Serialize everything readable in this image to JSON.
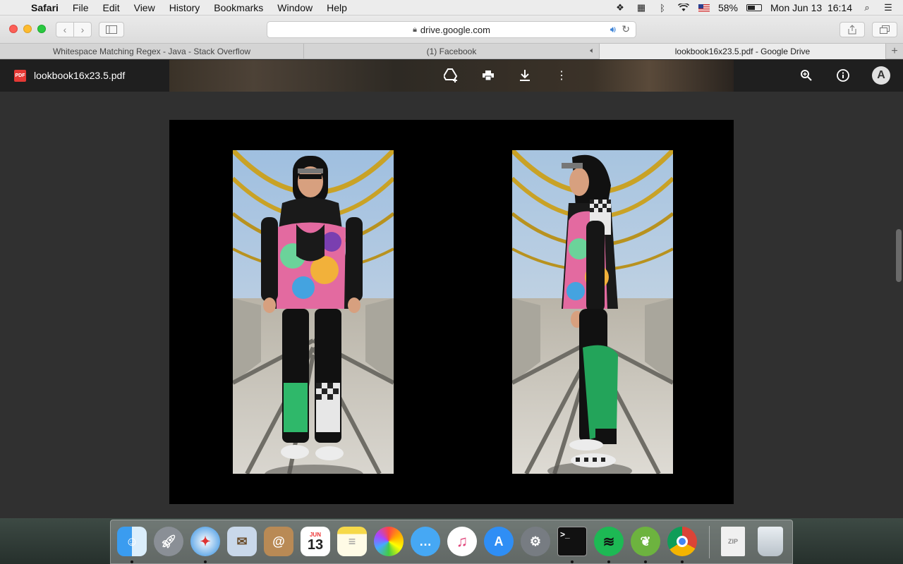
{
  "menubar": {
    "app": "Safari",
    "items": [
      "File",
      "Edit",
      "View",
      "History",
      "Bookmarks",
      "Window",
      "Help"
    ],
    "battery": "58%",
    "battery_level": 0.58,
    "datetime": "Mon Jun 13  16:14"
  },
  "toolbar": {
    "url": "drive.google.com"
  },
  "tabs": [
    {
      "title": "Whitespace Matching Regex - Java - Stack Overflow",
      "active": false
    },
    {
      "title": "(1) Facebook",
      "active": false,
      "muted_icon": true
    },
    {
      "title": "lookbook16x23.5.pdf - Google Drive",
      "active": true
    }
  ],
  "viewer": {
    "file_badge": "PDF",
    "file_name": "lookbook16x23.5.pdf",
    "avatar_letter": "A",
    "icons": [
      "add-to-drive-icon",
      "print-icon",
      "download-icon",
      "more-vert-icon",
      "zoom-in-icon",
      "info-icon"
    ]
  },
  "dock": {
    "apps": [
      "Finder",
      "Launchpad",
      "Safari",
      "Mail",
      "Contacts",
      "Calendar",
      "Notes",
      "Photos",
      "Messages",
      "iTunes",
      "App Store",
      "System Preferences",
      "Terminal",
      "Spotify",
      "Spring Tool Suite",
      "Chrome",
      "Archive",
      "Trash"
    ],
    "calendar_month": "JUN",
    "calendar_day": "13"
  }
}
